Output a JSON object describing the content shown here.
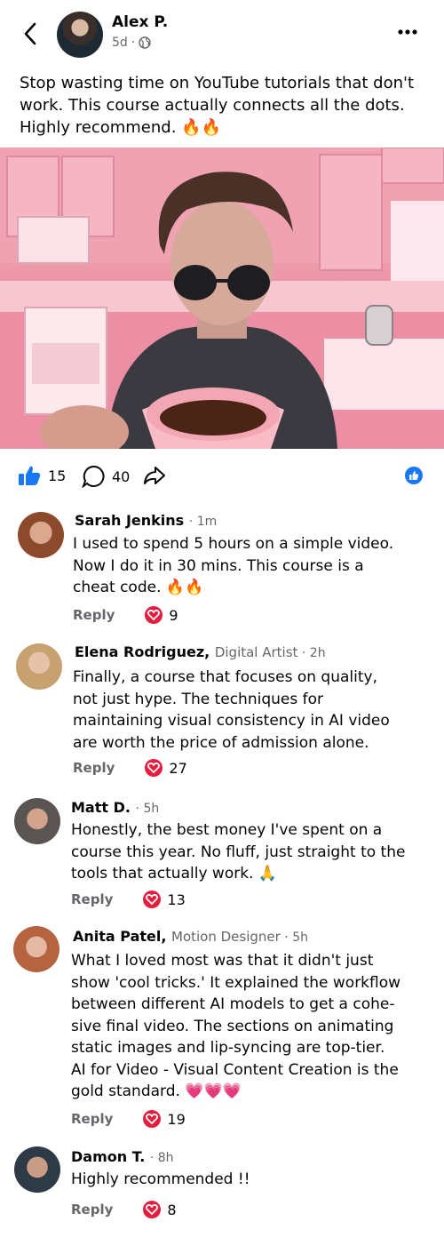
{
  "post": {
    "author": "Alex P.",
    "time": "5d",
    "text": "Stop wasting time on YouTube tutorials that don't work. This course actually connects all the dots. Highly recommend. 🔥🔥",
    "like_count": "15",
    "comment_count": "40"
  },
  "comments": [
    {
      "name": "Sarah Jenkins",
      "role": "",
      "time": "1m",
      "text": "I used to spend 5 hours on a simple video. Now I do it in 30 mins. This course is a cheat code. 🔥🔥",
      "reply": "Reply",
      "likes": "9"
    },
    {
      "name": "Elena Rodriguez,",
      "role": "Digital Artist",
      "time": "2h",
      "text": "Finally, a course that focuses on quality, not just hype. The techniques for maintaining visual consistency in AI video are worth the price of admission alone.",
      "reply": "Reply",
      "likes": "27"
    },
    {
      "name": "Matt D.",
      "role": "",
      "time": "5h",
      "text": "Honestly, the best money I've spent on a course this year. No fluff, just straight to the tools that actually work. 🙏",
      "reply": "Reply",
      "likes": "13"
    },
    {
      "name": "Anita Patel,",
      "role": "Motion Designer",
      "time": "5h",
      "text": "What I loved most was that it didn't just show 'cool tricks.' It explained the workflow between different AI models to get a cohe-sive final video. The sections on animating static images and lip-syncing are top-tier. AI for Video - Visual Content Creation is the gold standard. 💗💗💗",
      "reply": "Reply",
      "likes": "19"
    },
    {
      "name": "Damon T.",
      "role": "",
      "time": "8h",
      "text": "Highly recommended !!",
      "reply": "Reply",
      "likes": "8"
    }
  ]
}
